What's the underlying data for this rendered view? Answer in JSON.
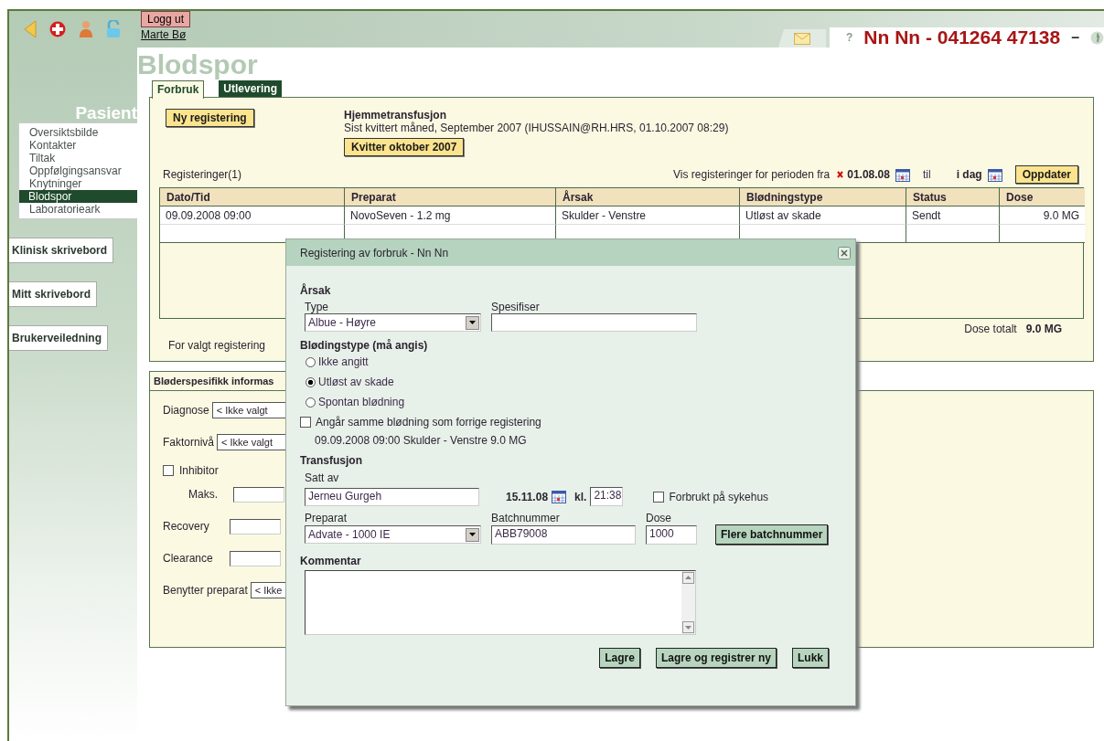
{
  "toolbar": {
    "logout_button": "Logg ut",
    "user_link": "Marte Bø",
    "help": "?",
    "patient": "Nn Nn - 041264 47138",
    "separator": "–"
  },
  "sidebar": {
    "heading": "Pasient",
    "menu": [
      {
        "label": "Oversiktsbilde",
        "selected": false
      },
      {
        "label": "Kontakter",
        "selected": false
      },
      {
        "label": "Tiltak",
        "selected": false
      },
      {
        "label": "Oppfølgingsansvar",
        "selected": false
      },
      {
        "label": "Knytninger",
        "selected": false
      },
      {
        "label": "Blodspor",
        "selected": true
      },
      {
        "label": "Laboratorieark",
        "selected": false
      }
    ],
    "buttons": [
      "Klinisk skrivebord",
      "Mitt skrivebord",
      "Brukerveiledning"
    ]
  },
  "page_title": "Blodspor",
  "tabs": [
    {
      "label": "Forbruk",
      "selected": true
    },
    {
      "label": "Utlevering",
      "selected": false
    }
  ],
  "consumption": {
    "new_button": "Ny registering",
    "home_title": "Hjemmetransfusjon",
    "last_receipt": "Sist kvittert måned, September 2007 (IHUSSAIN@RH.HRS, 01.10.2007 08:29)",
    "receipt_button": "Kvitter oktober 2007",
    "count_label": "Registeringer(1)",
    "period_label": "Vis registeringer for perioden fra",
    "from_date": "01.08.08",
    "to_label": "til",
    "to_date": "i dag",
    "update_button": "Oppdater",
    "table": {
      "columns": [
        "Dato/Tid",
        "Preparat",
        "Årsak",
        "Blødningstype",
        "Status",
        "Dose"
      ],
      "rows": [
        [
          "09.09.2008 09:00",
          "NovoSeven - 1.2 mg",
          "Skulder - Venstre",
          "Utløst av skade",
          "Sendt",
          "9.0 MG"
        ]
      ]
    },
    "dose_total_label": "Dose totalt",
    "dose_total": "9.0 MG",
    "selected_label": "For valgt registering"
  },
  "bleeder_info": {
    "heading": "Bløderspesifikk informas",
    "fields": [
      {
        "kind": "select",
        "label": "Diagnose",
        "value": "< Ikke valgt"
      },
      {
        "kind": "select",
        "label": "Faktornivå",
        "value": "< Ikke valgt"
      },
      {
        "kind": "checkbox",
        "label": "Inhibitor",
        "checked": false
      },
      {
        "kind": "subinput",
        "label": "Maks."
      },
      {
        "kind": "input",
        "label": "Recovery"
      },
      {
        "kind": "input",
        "label": "Clearance"
      },
      {
        "kind": "select",
        "label": "Benytter preparat",
        "value": "< Ikke"
      }
    ]
  },
  "dialog": {
    "title": "Registering av forbruk - Nn Nn",
    "cause": {
      "heading": "Årsak",
      "type_label": "Type",
      "type_value": "Albue - Høyre",
      "spec_label": "Spesifiser"
    },
    "bleeding": {
      "heading": "Blødingstype (må angis)",
      "options": [
        {
          "label": "Ikke angitt",
          "selected": false
        },
        {
          "label": "Utløst av skade",
          "selected": true
        },
        {
          "label": "Spontan blødning",
          "selected": false
        }
      ]
    },
    "same_bleeding": {
      "label": "Angår samme blødning som forrige registering",
      "checked": false,
      "detail": "09.09.2008 09:00 Skulder - Venstre 9.0 MG"
    },
    "transfusion": {
      "heading": "Transfusjon",
      "set_by_label": "Satt av",
      "set_by": "Jerneu Gurgeh",
      "date": "15.11.08",
      "time_label": "kl.",
      "time": "21:38",
      "in_hospital": {
        "label": "Forbrukt på sykehus",
        "checked": false
      },
      "product_label": "Preparat",
      "product": "Advate - 1000 IE",
      "batch_label": "Batchnummer",
      "batch": "ABB79008",
      "dose_label": "Dose",
      "dose": "1000",
      "more_batch_button": "Flere batchnummer"
    },
    "comment_label": "Kommentar",
    "buttons": [
      "Lagre",
      "Lagre og registrer ny",
      "Lukk"
    ]
  }
}
